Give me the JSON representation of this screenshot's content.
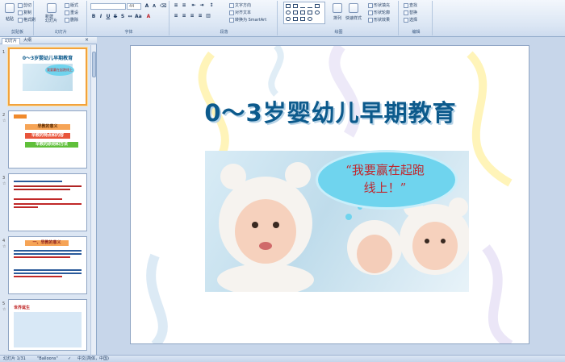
{
  "ribbon": {
    "clipboard": {
      "paste": "粘贴",
      "cut": "剪切",
      "copy": "复制",
      "format_painter": "格式刷",
      "label": "剪贴板"
    },
    "slides": {
      "new_slide": "新建\n幻灯片",
      "layout": "版式",
      "reset": "重设",
      "delete": "删除",
      "label": "幻灯片"
    },
    "font": {
      "font_name": "",
      "font_size": "44",
      "label": "字体"
    },
    "paragraph": {
      "text_direction": "文字方向",
      "align_text": "对齐文本",
      "smartart": "转换为 SmartArt",
      "label": "段落"
    },
    "drawing": {
      "arrange": "排列",
      "quick_styles": "快速样式",
      "shape_fill": "形状填充",
      "shape_outline": "形状轮廓",
      "shape_effects": "形状效果",
      "label": "绘图"
    },
    "editing": {
      "find": "查找",
      "replace": "替换",
      "select": "选择",
      "label": "编辑"
    }
  },
  "pane": {
    "tab_slides": "幻灯片",
    "tab_outline": "大纲",
    "close": "×",
    "thumbs": [
      {
        "num": "1",
        "title": "0～3岁婴幼儿早期教育",
        "bubble": "我要赢在起跑线上"
      },
      {
        "num": "2",
        "items": [
          "早教的意义",
          "早教的特点和内容",
          "早教的原则和方法"
        ]
      },
      {
        "num": "3"
      },
      {
        "num": "4",
        "heading": "一、早教的意义"
      },
      {
        "num": "5",
        "heading": "世界诞生"
      }
    ]
  },
  "slide": {
    "title": "0～3岁婴幼儿早期教育",
    "bubble_line1": "“我要赢在起跑",
    "bubble_line2": "线上！”"
  },
  "status": {
    "slide_info": "幻灯片 1/31",
    "theme": "\"Balloons\"",
    "language": "中文(简体，中国)"
  },
  "colors": {
    "title": "#0c5a8c",
    "bubble": "#6fd4ee",
    "bubble_text": "#c0272d",
    "selection": "#f2a23c"
  }
}
